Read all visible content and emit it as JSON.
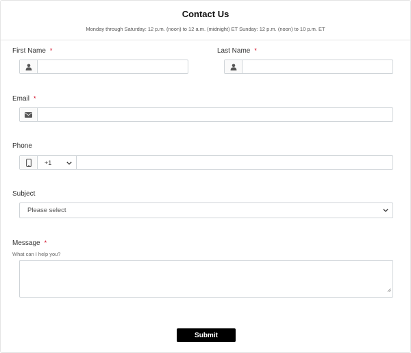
{
  "form": {
    "title": "Contact Us",
    "subtitle": "Monday through Saturday: 12 p.m. (noon) to 12 a.m. (midnight) ET Sunday: 12 p.m. (noon) to 10 p.m. ET",
    "required_marker": "*",
    "first_name": {
      "label": "First Name",
      "value": "",
      "placeholder": "",
      "icon": "user-icon"
    },
    "last_name": {
      "label": "Last Name",
      "value": "",
      "placeholder": "",
      "icon": "user-icon"
    },
    "email": {
      "label": "Email",
      "value": "",
      "placeholder": "",
      "icon": "envelope-icon"
    },
    "phone": {
      "label": "Phone",
      "country_code": "+1",
      "value": "",
      "placeholder": "",
      "icon": "mobile-phone-icon"
    },
    "subject": {
      "label": "Subject",
      "selected": "Please select"
    },
    "message": {
      "label": "Message",
      "hint": "What can I help you?",
      "value": ""
    },
    "submit_label": "Submit"
  },
  "colors": {
    "required": "#d0021b",
    "button_bg": "#000000",
    "button_text": "#ffffff",
    "border": "#cfd4d8",
    "icon": "#555555"
  }
}
